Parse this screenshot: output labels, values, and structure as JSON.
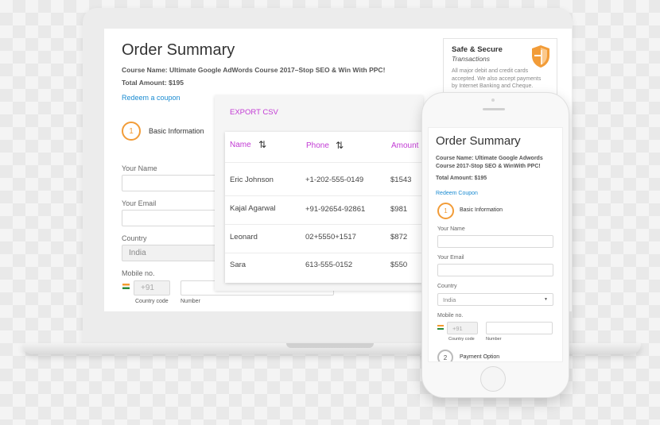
{
  "desktop": {
    "title": "Order Summary",
    "course_name": "Course Name: Ultimate Google AdWords Course 2017–Stop SEO & Win With PPC!",
    "total_amount": "Total Amount: $195",
    "redeem_coupon": "Redeem a coupon",
    "step1_number": "1",
    "step1_label": "Basic Information",
    "your_name_label": "Your Name",
    "your_email_label": "Your Email",
    "country_label": "Country",
    "country_value": "India",
    "mobile_label": "Mobile no.",
    "country_code_value": "+91",
    "country_code_caption": "Country code",
    "number_caption": "Number"
  },
  "safe_box": {
    "title": "Safe & Secure",
    "subtitle": "Transactions",
    "body_line1": "All major debit and credit cards",
    "body_line2": "accepted. We also accept payments",
    "body_line3": "by Internet Banking and Cheque."
  },
  "table": {
    "export_label": "EXPORT CSV",
    "columns": [
      "Name",
      "Phone",
      "Amount"
    ],
    "sort_icon": "⇅",
    "rows": [
      {
        "name": "Eric Johnson",
        "phone": "+1-202-555-0149",
        "amount": "$1543"
      },
      {
        "name": "Kajal Agarwal",
        "phone": "+91-92654-92861",
        "amount": "$981"
      },
      {
        "name": "Leonard",
        "phone": "02+5550+1517",
        "amount": "$872"
      },
      {
        "name": "Sara",
        "phone": "613-555-0152",
        "amount": "$550"
      }
    ]
  },
  "mobile": {
    "title": "Order Summary",
    "course_line1": "Course Name: Ultimate Google Adwords",
    "course_line2": "Course 2017-Stop SEO & WinWith PPC!",
    "total_amount": "Total Amount: $195",
    "redeem_coupon": "Redeem Coupon",
    "step1_number": "1",
    "step1_label": "Basic Information",
    "your_name_label": "Your Name",
    "your_email_label": "Your Email",
    "country_label": "Country",
    "country_value": "India",
    "mobile_label": "Mobile no.",
    "country_code_value": "+91",
    "country_code_caption": "Country code",
    "number_caption": "Number",
    "step2_number": "2",
    "step2_label": "Payment Option"
  },
  "colors": {
    "accent_orange": "#f29c38",
    "link_blue": "#1a8bd1",
    "table_header_purple": "#c23bd4"
  }
}
